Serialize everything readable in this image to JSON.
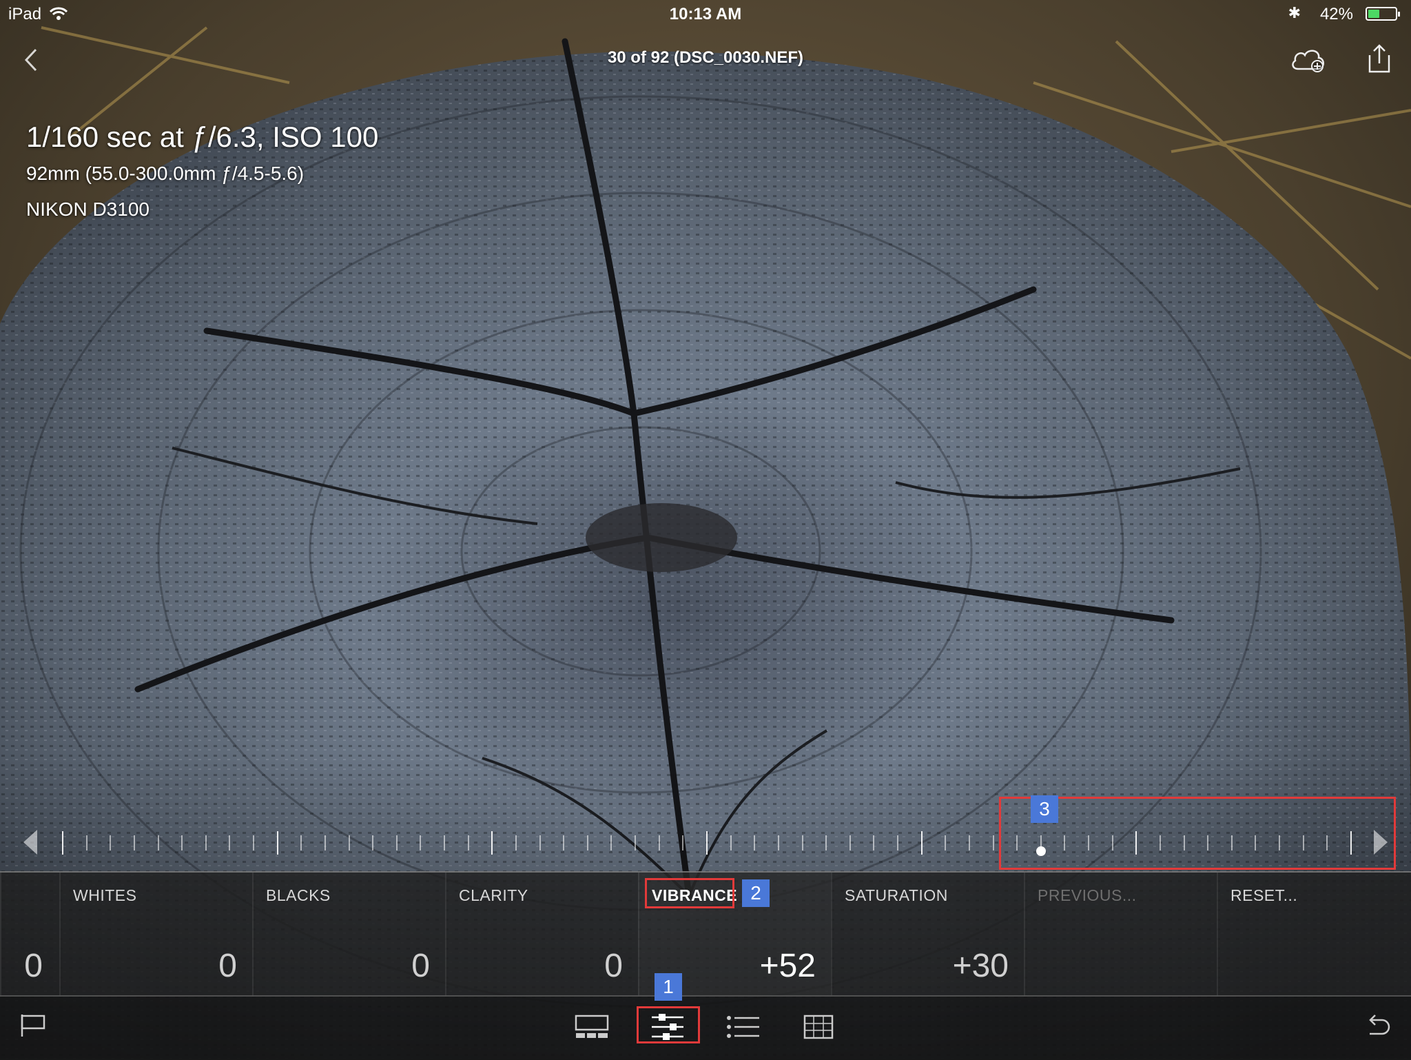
{
  "status": {
    "device": "iPad",
    "time": "10:13 AM",
    "battery_percent": "42%",
    "battery_level": 0.42,
    "bluetooth_glyph": "✱"
  },
  "nav": {
    "title": "30 of 92 (DSC_0030.NEF)"
  },
  "exif": {
    "exposure": "1/160 sec at ƒ/6.3, ISO 100",
    "lens": "92mm (55.0-300.0mm ƒ/4.5-5.6)",
    "camera": "NIKON D3100"
  },
  "slider": {
    "current_value": 52,
    "min": -100,
    "max": 100
  },
  "adjustments": [
    {
      "label": "",
      "value": "0"
    },
    {
      "label": "WHITES",
      "value": "0"
    },
    {
      "label": "BLACKS",
      "value": "0"
    },
    {
      "label": "CLARITY",
      "value": "0"
    },
    {
      "label": "VIBRANCE",
      "value": "+52"
    },
    {
      "label": "SATURATION",
      "value": "+30"
    },
    {
      "label": "PREVIOUS...",
      "value": ""
    },
    {
      "label": "RESET...",
      "value": ""
    }
  ],
  "annotations": {
    "toolbar_badge": "1",
    "vibrance_badge": "2",
    "slider_badge": "3"
  },
  "icons": {
    "back": "chevron-left-icon",
    "cloud": "cloud-add-icon",
    "share": "share-icon",
    "flag": "flag-icon",
    "filmstrip": "filmstrip-icon",
    "adjust": "sliders-icon",
    "presets": "list-icon",
    "crop": "crop-grid-icon",
    "undo": "undo-icon"
  },
  "colors": {
    "annotation_red": "#e23a3a",
    "annotation_blue": "#4a78d8",
    "battery_green": "#4cd964"
  }
}
